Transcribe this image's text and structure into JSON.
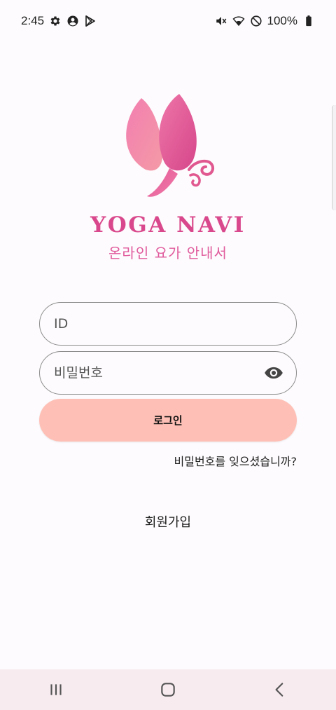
{
  "status_bar": {
    "time": "2:45",
    "battery": "100%",
    "left_icons": [
      "gear-icon",
      "account-icon",
      "play-store-icon"
    ],
    "right_icons": [
      "vibrate-mute-icon",
      "wifi-icon",
      "do-not-disturb-icon",
      "battery-icon"
    ]
  },
  "brand": {
    "name": "YOGA NAVI",
    "subtitle": "온라인 요가 안내서",
    "colors": {
      "primary": "#d9488c",
      "light": "#f49ab6"
    }
  },
  "login_form": {
    "id_placeholder": "ID",
    "password_placeholder": "비밀번호",
    "show_password_icon": "eye-icon",
    "login_button": "로그인",
    "login_button_color": "#fec0b6",
    "forgot_password": "비밀번호를 잊으셨습니까?",
    "signup": "회원가입"
  },
  "nav_bar": {
    "buttons": [
      "recent-apps-icon",
      "home-icon",
      "back-icon"
    ]
  }
}
